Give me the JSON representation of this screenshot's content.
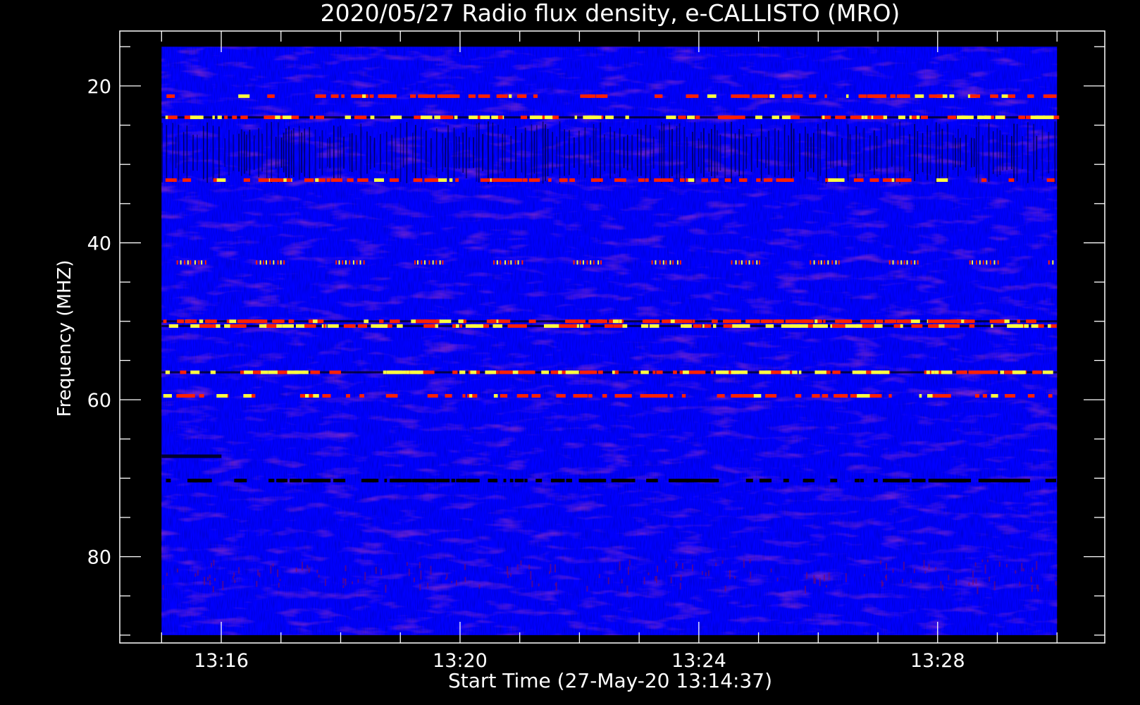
{
  "chart_data": {
    "type": "heatmap",
    "title": "2020/05/27  Radio flux density, e-CALLISTO (MRO)",
    "xlabel": "Start Time (27-May-20 13:14:37)",
    "ylabel": "Frequency (MHZ)",
    "x_major_ticks": [
      "13:16",
      "13:20",
      "13:24",
      "13:28"
    ],
    "y_major_ticks": [
      20,
      40,
      60,
      80
    ],
    "xlim_minutes_after_1300": [
      14.3,
      30.8
    ],
    "ylim_mhz": [
      91,
      13
    ],
    "data_xlim_minutes_after_1300": [
      15.0,
      30.0
    ],
    "data_ylim_mhz": [
      15,
      90
    ],
    "colors": {
      "background": "#0000ff",
      "noise_dark": "#00008a",
      "low": "#7a0a60",
      "mid": "#ff2000",
      "high": "#ffff40",
      "axes": "#ffffff",
      "page": "#000000"
    },
    "bands": [
      {
        "freq_mhz": 21.3,
        "level": "mid",
        "pattern": "scattered"
      },
      {
        "freq_mhz": 24.0,
        "level": "high",
        "pattern": "dashed"
      },
      {
        "freq_mhz": 28.5,
        "level": "dark",
        "pattern": "vertical-stripes"
      },
      {
        "freq_mhz": 32.0,
        "level": "mid",
        "pattern": "scattered"
      },
      {
        "freq_mhz": 42.5,
        "level": "high",
        "pattern": "periodic"
      },
      {
        "freq_mhz": 50.0,
        "level": "mid",
        "pattern": "dashed"
      },
      {
        "freq_mhz": 50.6,
        "level": "high",
        "pattern": "dashed"
      },
      {
        "freq_mhz": 56.5,
        "level": "high",
        "pattern": "dashed"
      },
      {
        "freq_mhz": 59.5,
        "level": "mid",
        "pattern": "scattered"
      },
      {
        "freq_mhz": 67.2,
        "level": "dark",
        "pattern": "segment"
      },
      {
        "freq_mhz": 70.3,
        "level": "dark",
        "pattern": "dashed"
      },
      {
        "freq_mhz": 82.0,
        "level": "low",
        "pattern": "diffuse"
      }
    ]
  }
}
